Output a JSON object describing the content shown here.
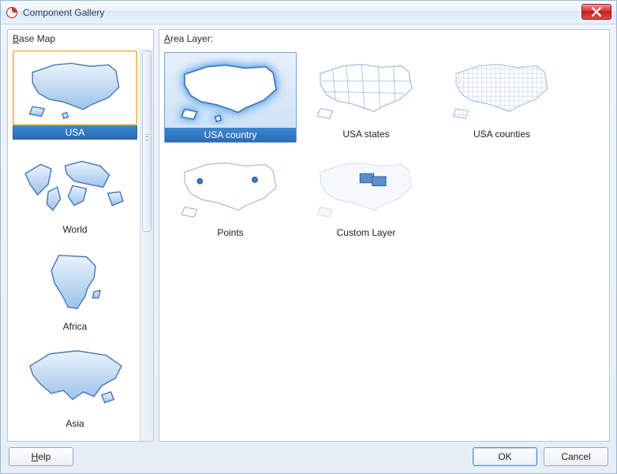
{
  "window": {
    "title": "Component Gallery"
  },
  "left_panel": {
    "label": "Base Map",
    "label_mnemonic": "B",
    "items": [
      {
        "id": "usa",
        "label": "USA",
        "selected": true
      },
      {
        "id": "world",
        "label": "World",
        "selected": false
      },
      {
        "id": "africa",
        "label": "Africa",
        "selected": false
      },
      {
        "id": "asia",
        "label": "Asia",
        "selected": false
      }
    ]
  },
  "right_panel": {
    "label": "Area Layer:",
    "label_mnemonic": "A",
    "items": [
      {
        "id": "usa-country",
        "label": "USA country",
        "selected": true
      },
      {
        "id": "usa-states",
        "label": "USA states",
        "selected": false
      },
      {
        "id": "usa-counties",
        "label": "USA counties",
        "selected": false
      },
      {
        "id": "points",
        "label": "Points",
        "selected": false
      },
      {
        "id": "custom-layer",
        "label": "Custom Layer",
        "selected": false
      }
    ]
  },
  "buttons": {
    "help": "Help",
    "ok": "OK",
    "cancel": "Cancel"
  }
}
